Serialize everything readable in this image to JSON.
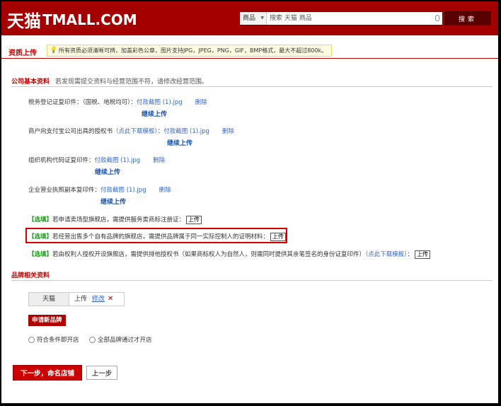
{
  "header": {
    "logo_cn": "天猫",
    "logo_en": "TMALL.COM",
    "search_category": "商品",
    "search_placeholder": "搜索 天猫 商品",
    "search_button": "搜索"
  },
  "page": {
    "title": "资质上传",
    "tip": "所有资质必须清晰可辨，加盖彩色公章，图片支持JPG，JPEG，PNG，GIF，BMP格式，最大不超过800k。"
  },
  "company_section": {
    "title": "公司基本资料",
    "note": "若发现需提交资料与经营范围不符，请修改经营范围。",
    "items": [
      {
        "label": "税务登记证复印件：（国税、地税均可）：",
        "file": "付款截图 (1).jpg",
        "delete": "删除",
        "continue": "继续上传"
      },
      {
        "label": "商户向支付宝公司出具的授权书",
        "template": "（点此下载模板）",
        "label_suffix": "：",
        "file": "付款截图 (1).jpg",
        "delete": "删除",
        "continue": "继续上传"
      },
      {
        "label": "组织机构代码证复印件：",
        "file": "付款截图 (1).jpg",
        "delete": "删除",
        "continue": "继续上传"
      },
      {
        "label": "企业营业执照副本复印件：",
        "file": "付款截图 (1).jpg",
        "delete": "删除",
        "continue": "继续上传"
      }
    ],
    "optional": [
      {
        "tag": "【选填】",
        "text": "若申请卖场型旗舰店，需提供服务类商标注册证：",
        "upload": "上传"
      },
      {
        "tag": "【选填】",
        "text": "若经营出售多个自有品牌的旗舰店，需提供品牌属于同一实际控制人的证明材料：",
        "upload": "上传"
      },
      {
        "tag": "【选填】",
        "text": "若由权利人授权开设旗舰店，需提供排他授权书（如果商标权人为自然人，则需同时提供其亲笔签名的身份证复印件）",
        "template": "（点此下载模板）",
        "suffix": "：",
        "upload": "上传"
      }
    ]
  },
  "brand_section": {
    "title": "品牌相关资料",
    "brand_name": "天猫",
    "uploaded": "上传",
    "edit": "修改",
    "remove": "✕",
    "apply_button": "申请新品牌",
    "radio_1": "符合条件即开店",
    "radio_2": "全部品牌通过才开店"
  },
  "footer": {
    "next_button": "下一步，命名店铺",
    "prev_button": "上一步"
  },
  "colors": {
    "brand_red": "#a40000",
    "link_blue": "#3366cc",
    "optional_green": "#1a9a1a",
    "highlight": "#d10000"
  }
}
